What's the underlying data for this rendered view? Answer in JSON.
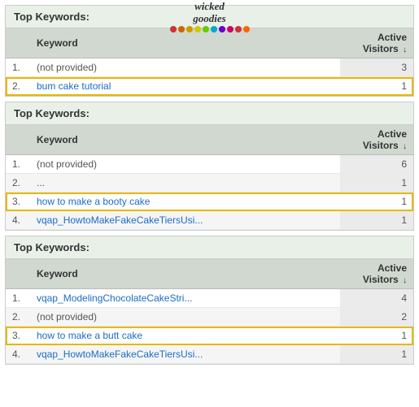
{
  "panels": [
    {
      "title": "Top Keywords:",
      "has_logo": true,
      "logo": {
        "line1": "wicked",
        "line2": "goodies",
        "dots": [
          "#cc3333",
          "#cc6600",
          "#cc9900",
          "#cccc00",
          "#66cc00",
          "#00aacc",
          "#6600cc",
          "#cc0066",
          "#cc3333",
          "#ff6600"
        ]
      },
      "headers": {
        "keyword": "Keyword",
        "visitors": "Active Visitors"
      },
      "rows": [
        {
          "num": "1.",
          "keyword": "(not provided)",
          "visitors": "3",
          "highlighted": false,
          "plain": true
        },
        {
          "num": "2.",
          "keyword": "bum cake tutorial",
          "visitors": "1",
          "highlighted": true,
          "plain": false
        }
      ]
    },
    {
      "title": "Top Keywords:",
      "has_logo": false,
      "headers": {
        "keyword": "Keyword",
        "visitors": "Active Visitors"
      },
      "rows": [
        {
          "num": "1.",
          "keyword": "(not provided)",
          "visitors": "6",
          "highlighted": false,
          "plain": true
        },
        {
          "num": "2.",
          "keyword": "...",
          "visitors": "1",
          "highlighted": false,
          "plain": true
        },
        {
          "num": "3.",
          "keyword": "how to make a booty cake",
          "visitors": "1",
          "highlighted": true,
          "plain": false
        },
        {
          "num": "4.",
          "keyword": "vqap_HowtoMakeFakeCakeTiersUsi...",
          "visitors": "1",
          "highlighted": false,
          "plain": false
        }
      ]
    },
    {
      "title": "Top Keywords:",
      "has_logo": false,
      "headers": {
        "keyword": "Keyword",
        "visitors": "Active Visitors"
      },
      "rows": [
        {
          "num": "1.",
          "keyword": "vqap_ModelingChocolateCakeStri...",
          "visitors": "4",
          "highlighted": false,
          "plain": false
        },
        {
          "num": "2.",
          "keyword": "(not provided)",
          "visitors": "2",
          "highlighted": false,
          "plain": true
        },
        {
          "num": "3.",
          "keyword": "how to make a butt cake",
          "visitors": "1",
          "highlighted": true,
          "plain": false
        },
        {
          "num": "4.",
          "keyword": "vqap_HowtoMakeFakeCakeTiersUsi...",
          "visitors": "1",
          "highlighted": false,
          "plain": false
        }
      ]
    }
  ]
}
